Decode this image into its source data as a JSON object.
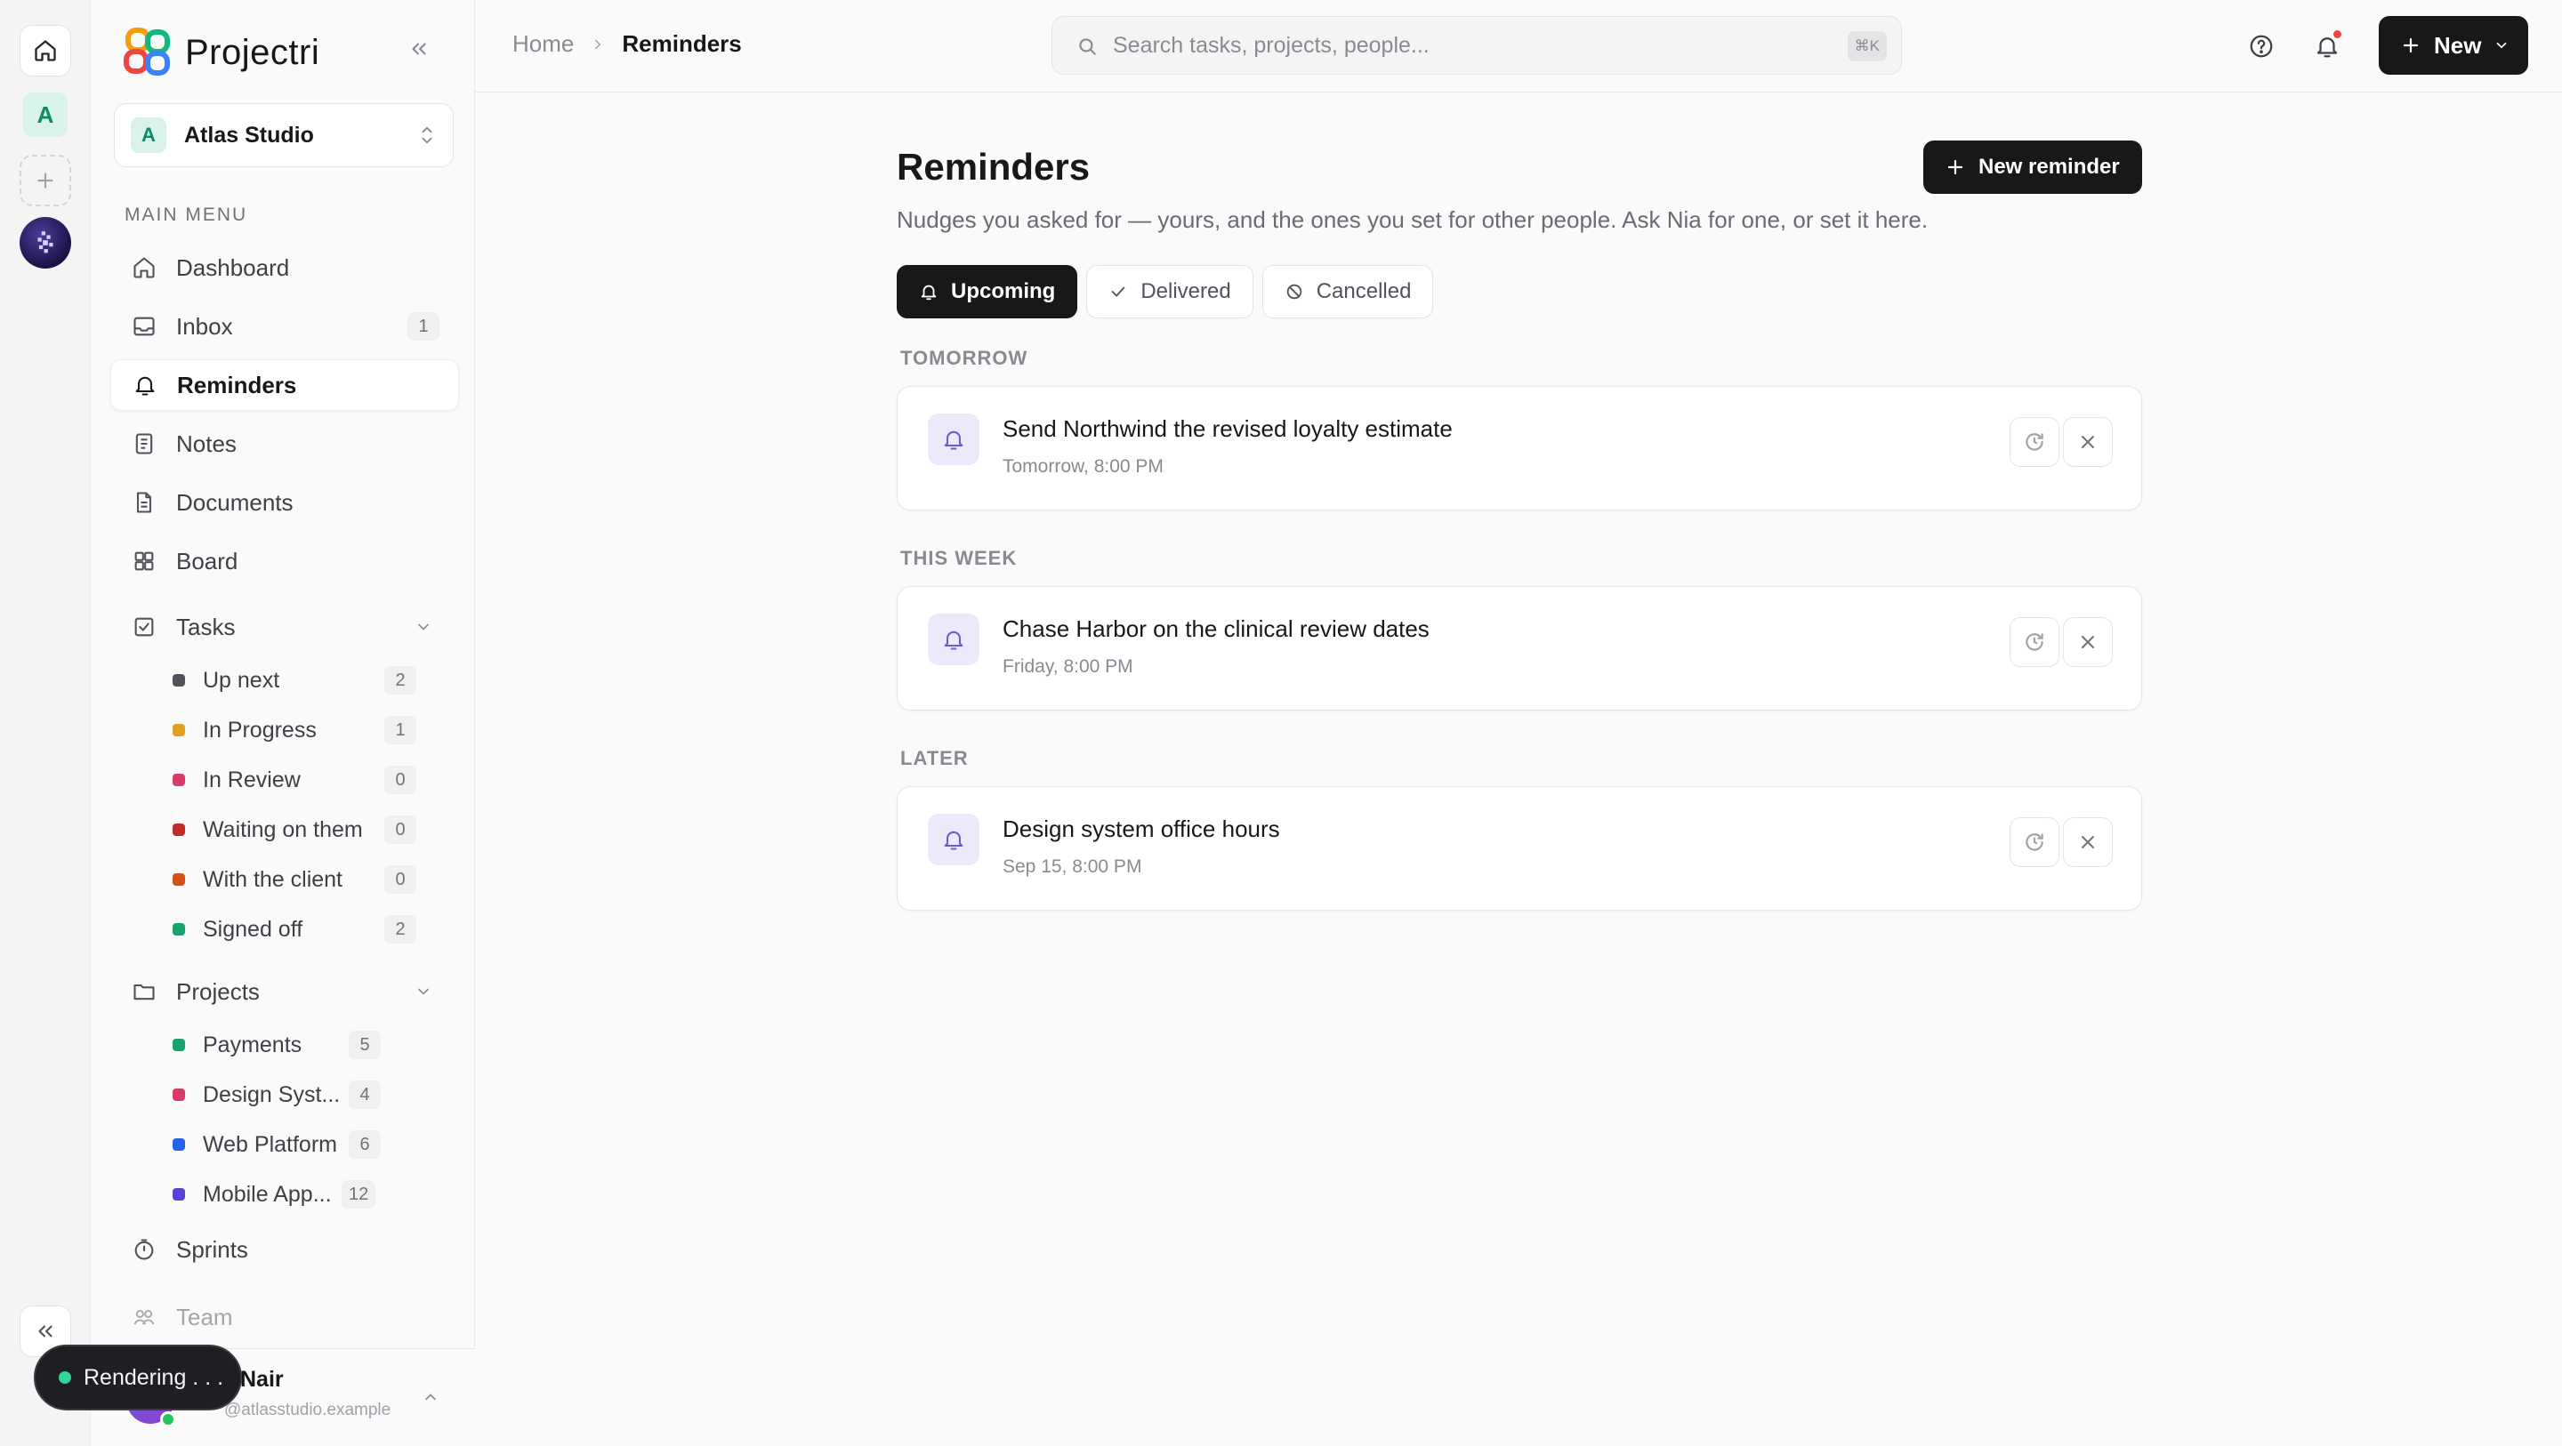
{
  "app": {
    "name": "Projectri"
  },
  "rail": {
    "workspace_initial": "A"
  },
  "workspace": {
    "initial": "A",
    "name": "Atlas Studio"
  },
  "sidebar": {
    "section_label": "MAIN MENU",
    "items": [
      {
        "label": "Dashboard",
        "icon": "home-icon"
      },
      {
        "label": "Inbox",
        "icon": "inbox-icon",
        "count": "1"
      },
      {
        "label": "Reminders",
        "icon": "bell-icon",
        "active": true
      },
      {
        "label": "Notes",
        "icon": "notes-icon"
      },
      {
        "label": "Documents",
        "icon": "document-icon"
      },
      {
        "label": "Board",
        "icon": "board-icon"
      },
      {
        "label": "Tasks",
        "icon": "checkbox-icon"
      },
      {
        "label": "Projects",
        "icon": "folder-icon"
      },
      {
        "label": "Sprints",
        "icon": "timer-icon"
      },
      {
        "label": "Team",
        "icon": "team-icon"
      }
    ],
    "task_statuses": [
      {
        "label": "Up next",
        "count": "2",
        "color": "#52525b"
      },
      {
        "label": "In Progress",
        "count": "1",
        "color": "#e0a020"
      },
      {
        "label": "In Review",
        "count": "0",
        "color": "#d63b6a"
      },
      {
        "label": "Waiting on them",
        "count": "0",
        "color": "#c42a2a"
      },
      {
        "label": "With the client",
        "count": "0",
        "color": "#d2501a"
      },
      {
        "label": "Signed off",
        "count": "2",
        "color": "#16a46c"
      }
    ],
    "projects": [
      {
        "label": "Payments",
        "count": "5",
        "color": "#16a46c"
      },
      {
        "label": "Design Syst...",
        "count": "4",
        "color": "#d63b6a"
      },
      {
        "label": "Web Platform",
        "count": "6",
        "color": "#2563eb"
      },
      {
        "label": "Mobile App...",
        "count": "12",
        "color": "#5b3fd6"
      }
    ]
  },
  "user": {
    "name": "Nair",
    "email": "@atlasstudio.example"
  },
  "toast": {
    "text": "Rendering . . ."
  },
  "header": {
    "breadcrumb_home": "Home",
    "breadcrumb_current": "Reminders",
    "search_placeholder": "Search tasks, projects, people...",
    "search_shortcut": "⌘K",
    "new_button": "New"
  },
  "page": {
    "title": "Reminders",
    "subtitle": "Nudges you asked for — yours, and the ones you set for other people. Ask Nia for one, or set it here.",
    "new_reminder_button": "New reminder",
    "tabs": [
      {
        "label": "Upcoming",
        "active": true
      },
      {
        "label": "Delivered"
      },
      {
        "label": "Cancelled"
      }
    ],
    "groups": [
      {
        "label": "TOMORROW",
        "reminders": [
          {
            "title": "Send Northwind the revised loyalty estimate",
            "time": "Tomorrow, 8:00 PM"
          }
        ]
      },
      {
        "label": "THIS WEEK",
        "reminders": [
          {
            "title": "Chase Harbor on the clinical review dates",
            "time": "Friday, 8:00 PM"
          }
        ]
      },
      {
        "label": "LATER",
        "reminders": [
          {
            "title": "Design system office hours",
            "time": "Sep 15, 8:00 PM"
          }
        ]
      }
    ]
  },
  "colors": {
    "accent": "#18181b",
    "reminder_icon_bg": "#ede9fb",
    "reminder_icon": "#6d5bd0"
  }
}
